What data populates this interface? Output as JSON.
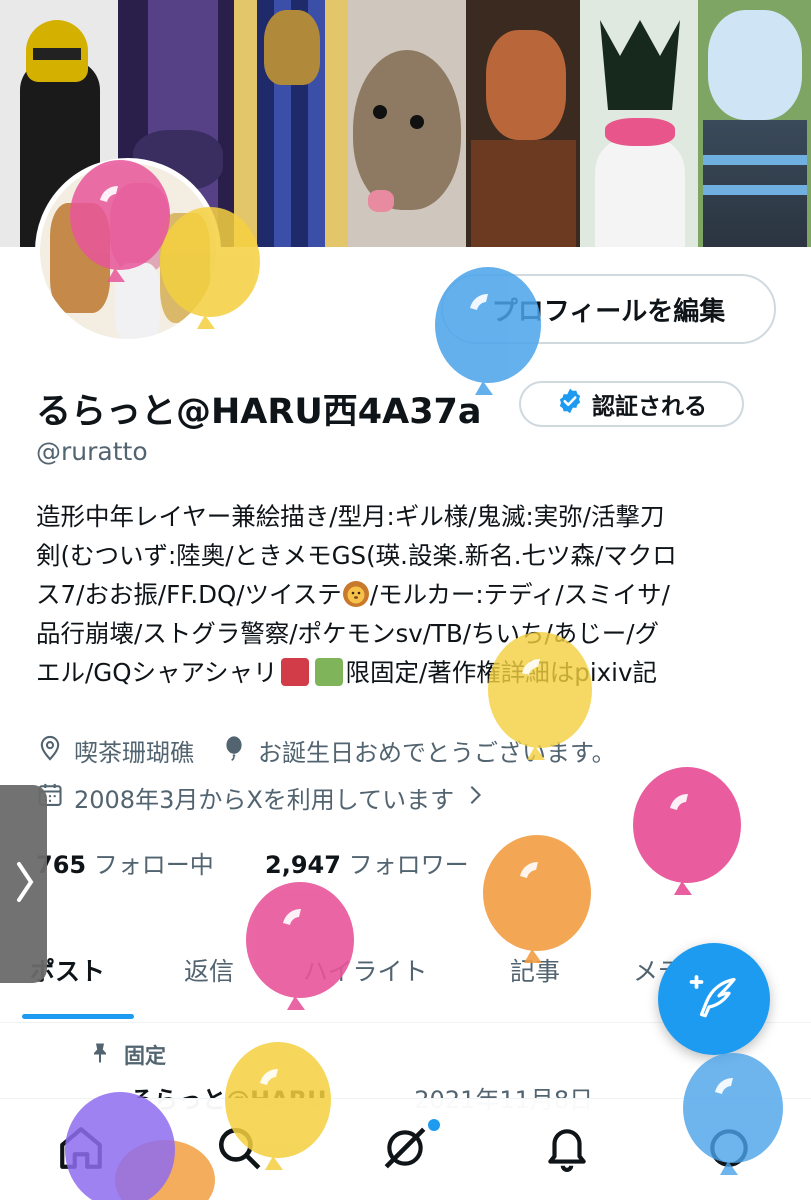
{
  "profile": {
    "edit_label": "プロフィールを編集",
    "display_name": "るらっと@HARU西4A37a",
    "verify_label": "認証される",
    "handle": "@ruratto",
    "bio_lines": [
      "造形中年レイヤー兼絵描き/型月:ギル様/鬼滅:実弥/活撃刀",
      "剣(むついず:陸奥/ときメモGS(瑛.設楽.新名.七ツ森/マクロ",
      "ス7/おお振/FF.DQ/ツイステ",
      "/モルカー:テディ/スミイサ/",
      "品行崩壊/ストグラ警察/ポケモンsv/TB/ちいち/あじー/グ",
      "エル/GQシャアシャリ",
      "限固定/著作権詳細はpixiv記"
    ],
    "location": "喫茶珊瑚礁",
    "birthday": "お誕生日おめでとうございます。",
    "joined": "2008年3月からXを利用しています",
    "following_count": "765",
    "following_label": "フォロー中",
    "followers_count": "2,947",
    "followers_label": "フォロワー"
  },
  "tabs": [
    "ポスト",
    "返信",
    "ハイライト",
    "記事",
    "メデ"
  ],
  "pinned": {
    "label": "固定",
    "author": "るらっと@HARU",
    "date": "2021年11月8日"
  },
  "icons": {
    "location": "location-pin-icon",
    "birthday": "balloon-icon",
    "calendar": "calendar-icon",
    "compose": "compose-feather-icon",
    "home": "home-icon",
    "search": "search-icon",
    "grok": "grok-icon",
    "notifications": "bell-icon",
    "messages": "message-icon"
  },
  "colors": {
    "accent": "#1d9bf0",
    "text_secondary": "#536471",
    "balloon_pink": "#e8559a",
    "balloon_yellow": "#f4d03f",
    "balloon_blue": "#4aa3ea",
    "balloon_orange": "#f29d41",
    "balloon_purple": "#8e6cf0"
  }
}
